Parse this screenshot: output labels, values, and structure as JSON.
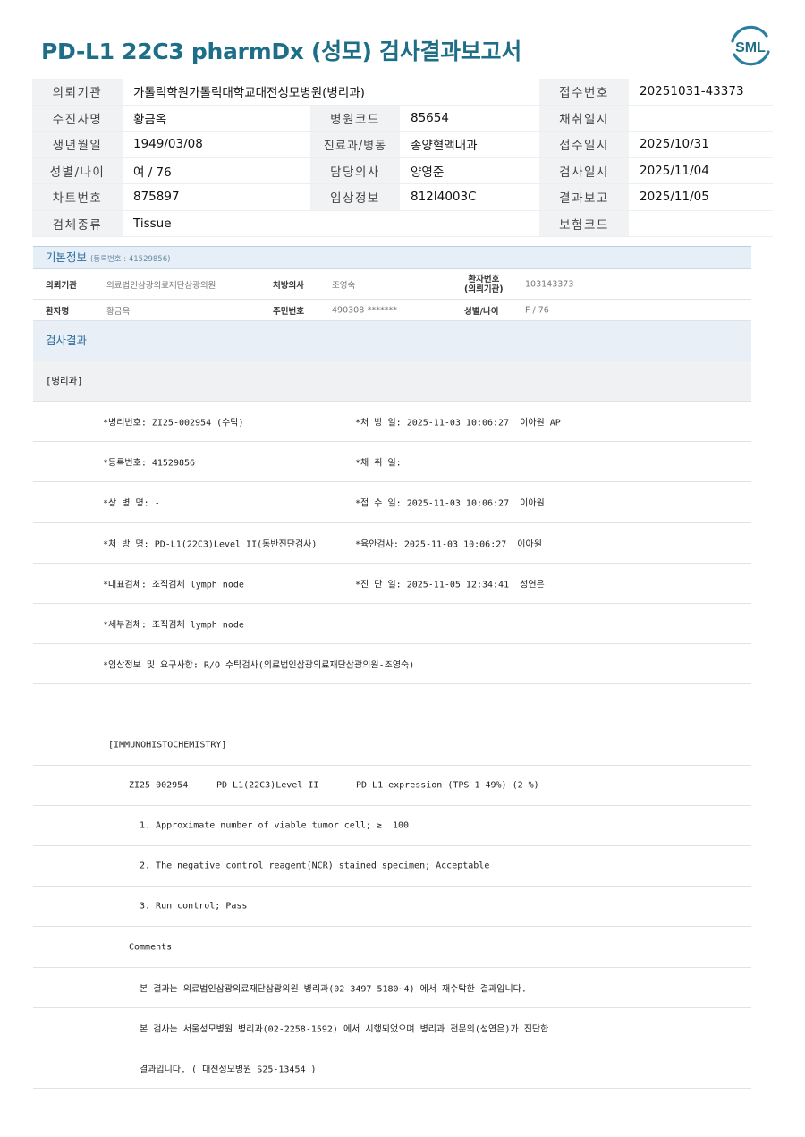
{
  "report": {
    "title": "PD-L1 22C3 pharmDx (성모) 검사결과보고서",
    "logo_text": "SML",
    "accent_color": "#1d6e86"
  },
  "header": {
    "institution_label": "의뢰기관",
    "institution": "가톨릭학원가톨릭대학교대전성모병원(병리과)",
    "receipt_no_label": "접수번호",
    "receipt_no": "20251031-43373",
    "patient_label": "수진자명",
    "patient": "황금옥",
    "hospital_code_label": "병원코드",
    "hospital_code": "85654",
    "collection_date_label": "채취일시",
    "collection_date": "",
    "birth_label": "생년월일",
    "birth": "1949/03/08",
    "department_label": "진료과/병동",
    "department": "종양혈액내과",
    "receipt_date_label": "접수일시",
    "receipt_date": "2025/10/31",
    "sex_age_label": "성별/나이",
    "sex_age": "여 / 76",
    "doctor_label": "담당의사",
    "doctor": "양영준",
    "test_date_label": "검사일시",
    "test_date": "2025/11/04",
    "chart_no_label": "차트번호",
    "chart_no": "875897",
    "clinical_label": "임상정보",
    "clinical": "812I4003C",
    "report_date_label": "결과보고",
    "report_date": "2025/11/05",
    "specimen_label": "검체종류",
    "specimen": "Tissue",
    "insurance_label": "보험코드",
    "insurance": ""
  },
  "basic": {
    "title": "기본정보",
    "reg_label": "(등록번호 : 41529856)",
    "institution_key": "의뢰기관",
    "institution_val": "의료법인삼광의료재단삼광의원",
    "prescriber_key": "처방의사",
    "prescriber_val": "조영숙",
    "patno_key1": "환자번호",
    "patno_key2": "(의뢰기관)",
    "patno_val": "103143373",
    "name_key": "환자명",
    "name_val": "황금옥",
    "rrn_key": "주민번호",
    "rrn_val": "490308-*******",
    "sexage_key": "성별/나이",
    "sexage_val": "F / 76"
  },
  "results": {
    "section_title": "검사결과",
    "category": "[병리과]",
    "rows": [
      {
        "left": "*병리번호: ZI25-002954 (수탁)",
        "right": "*처 방 일: 2025-11-03 10:06:27  이아원 AP"
      },
      {
        "left": "*등록번호: 41529856",
        "right": "*채 취 일:"
      },
      {
        "left": "*상 병 명: -",
        "right": "*접 수 일: 2025-11-03 10:06:27  이아원"
      },
      {
        "left": "*처 방 명: PD-L1(22C3)Level II(동반진단검사)",
        "right": "*육안검사: 2025-11-03 10:06:27  이아원"
      },
      {
        "left": "*대표검체: 조직검체 lymph node",
        "right": "*진 단 일: 2025-11-05 12:34:41  성연은"
      },
      {
        "left": "*세부검체: 조직검체 lymph node",
        "right": ""
      },
      {
        "left": "*임상정보 및 요구사항: R/O 수탁검사(의료법인삼광의료재단삼광의원-조영숙)",
        "right": ""
      }
    ],
    "ihc_title": "[IMMUNOHISTOCHEMISTRY]",
    "ihc_line": {
      "case": "ZI25-002954",
      "test": "PD-L1(22C3)Level II",
      "result": "PD-L1 expression (TPS 1-49%) (2 %)"
    },
    "items": [
      "1. Approximate number of viable tumor cell; ≥  100",
      "2. The negative control reagent(NCR) stained specimen; Acceptable",
      "3. Run control; Pass"
    ],
    "comments_label": "Comments",
    "comment_lines": [
      "본 결과는 의료법인삼광의료재단삼광의원 병리과(02-3497-5180~4) 에서 재수탁한 결과입니다.",
      "본 검사는 서울성모병원 병리과(02-2258-1592) 에서 시행되었으며 병리과 전문의(성연은)가 진단한",
      "결과입니다. ( 대전성모병원 S25-13454 )"
    ]
  }
}
